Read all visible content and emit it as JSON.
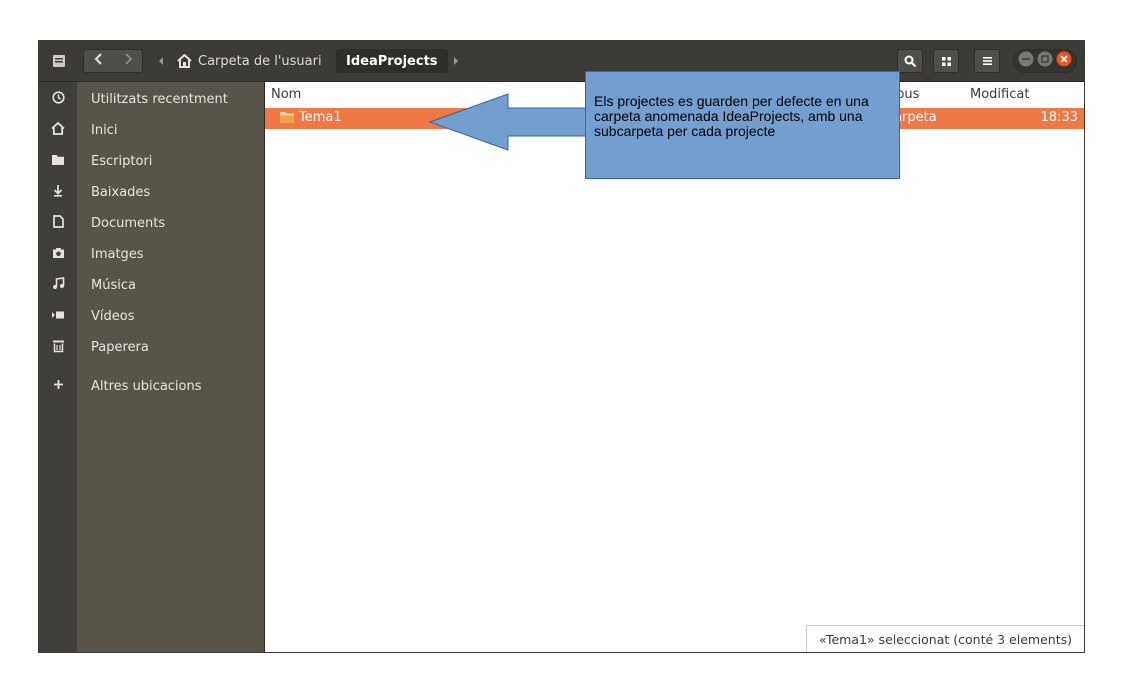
{
  "titlebar": {
    "back_icon": "chevron-left-icon",
    "forward_icon": "chevron-right-icon",
    "breadcrumb_home": "Carpeta de l'usuari",
    "breadcrumb_current": "IdeaProjects"
  },
  "sidebar": {
    "items": [
      {
        "label": "Utilitzats recentment",
        "icon": "clock-icon"
      },
      {
        "label": "Inici",
        "icon": "home-icon"
      },
      {
        "label": "Escriptori",
        "icon": "folder-icon"
      },
      {
        "label": "Baixades",
        "icon": "download-icon"
      },
      {
        "label": "Documents",
        "icon": "document-icon"
      },
      {
        "label": "Imatges",
        "icon": "camera-icon"
      },
      {
        "label": "Música",
        "icon": "music-icon"
      },
      {
        "label": "Vídeos",
        "icon": "video-icon"
      },
      {
        "label": "Paperera",
        "icon": "trash-icon"
      },
      {
        "label": "Altres ubicacions",
        "icon": "plus-icon"
      }
    ]
  },
  "main": {
    "columns": {
      "name": "Nom",
      "type": "Tipus",
      "modified": "Modificat"
    },
    "rows": [
      {
        "name": "Tema1",
        "type": "Carpeta",
        "modified": "18:33"
      }
    ],
    "status": "«Tema1» seleccionat (conté 3 elements)"
  },
  "callout": {
    "text": "Els projectes es guarden per defecte en una carpeta anomenada IdeaProjects, amb una subcarpeta per cada projecte"
  },
  "colors": {
    "selection": "#f07746",
    "callout": "#729fcf",
    "sidebar": "#58544a",
    "titlebar": "#3c3b37"
  }
}
